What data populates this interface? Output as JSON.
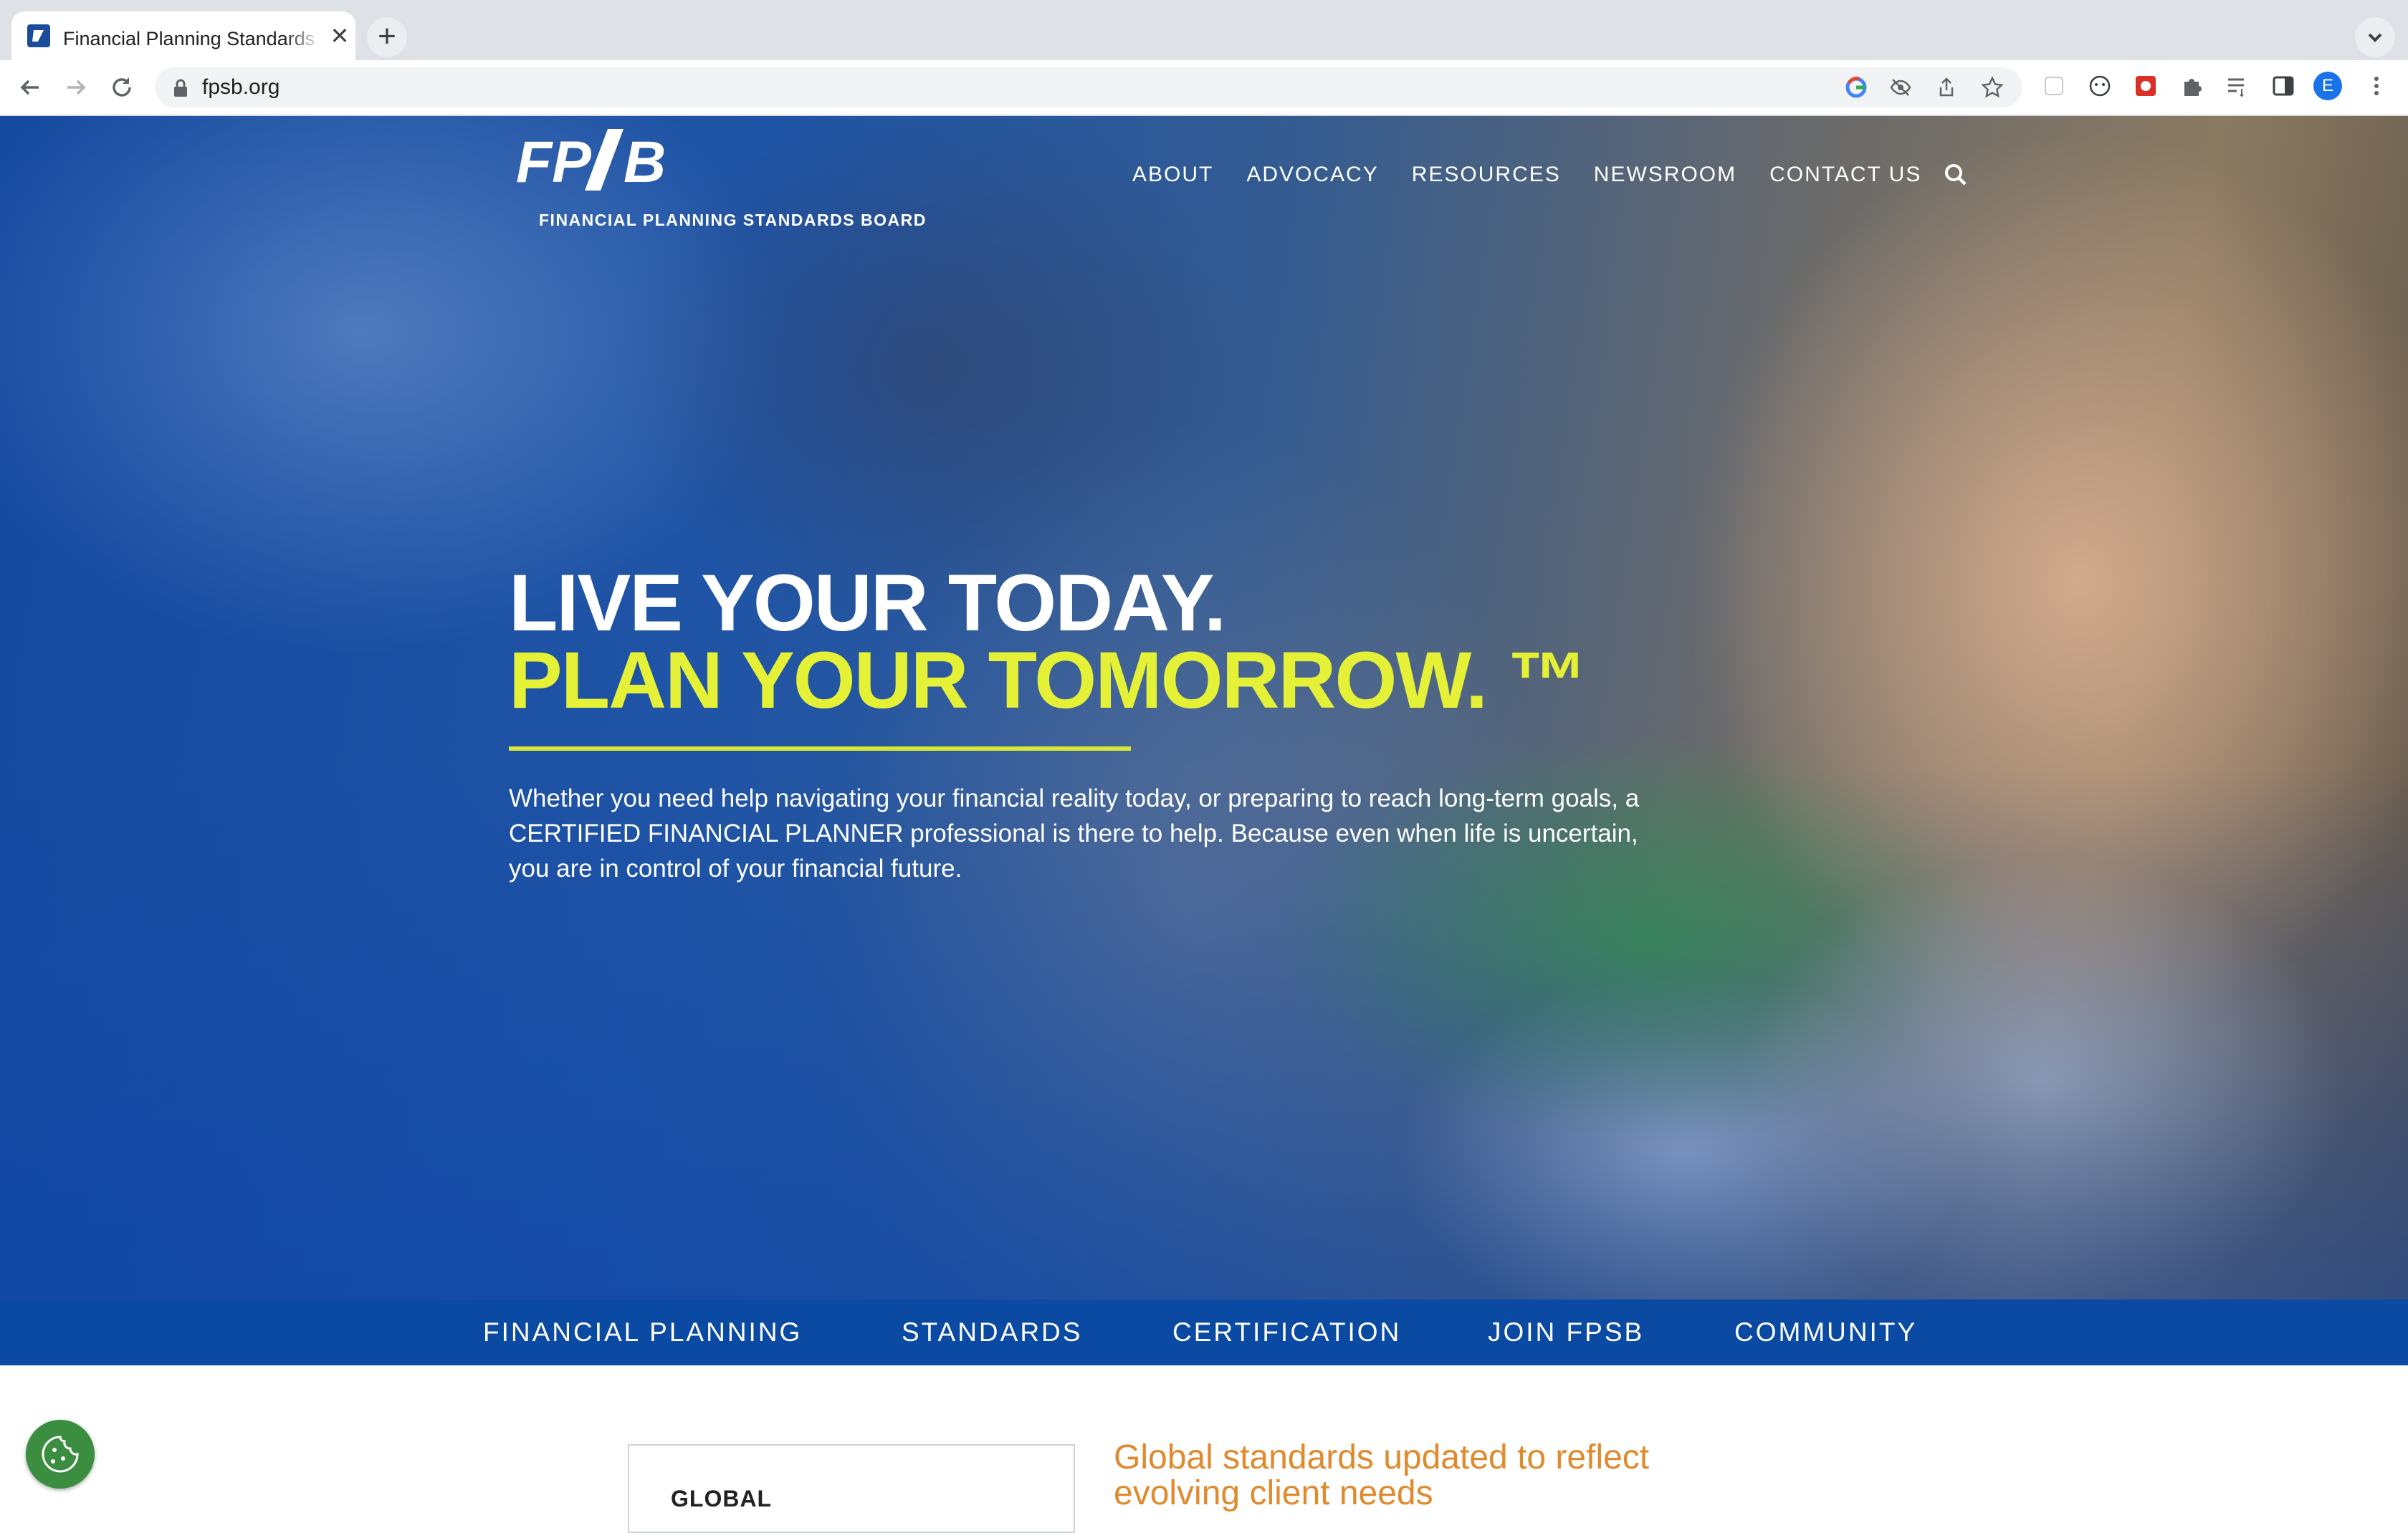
{
  "browser": {
    "tab_title": "Financial Planning Standards Board",
    "tab_close": "✕",
    "new_tab": "+",
    "url": "fpsb.org",
    "omnibox_icons": [
      "google-icon",
      "eye-slash-icon",
      "share-icon",
      "star-icon"
    ],
    "extension_icons": [
      "extension-placeholder-icon",
      "privacy-badger-icon",
      "red-extension-icon",
      "puzzle-icon",
      "reading-list-icon",
      "side-panel-icon"
    ],
    "profile_initial": "E"
  },
  "site": {
    "logo_text": "FPSB",
    "logo_subtitle": "FINANCIAL PLANNING STANDARDS BOARD",
    "top_nav": [
      "ABOUT",
      "ADVOCACY",
      "RESOURCES",
      "NEWSROOM",
      "CONTACT US"
    ]
  },
  "hero": {
    "headline_line1": "LIVE YOUR TODAY.",
    "headline_line2": "PLAN YOUR TOMORROW. ™",
    "body": "Whether you need help navigating your financial reality today, or preparing to reach long-term goals, a CERTIFIED FINANCIAL PLANNER professional is there to help. Because even when life is uncertain, you are in control of your financial future."
  },
  "main_nav": [
    "FINANCIAL PLANNING",
    "STANDARDS",
    "CERTIFICATION",
    "JOIN FPSB",
    "COMMUNITY"
  ],
  "below_fold": {
    "card_label": "GLOBAL",
    "news_title": "Global standards updated to reflect evolving client needs"
  },
  "colors": {
    "brand_blue": "#0b4aa2",
    "accent_yellow": "#e5f137",
    "news_orange": "#e08a2e",
    "cookie_green": "#3b8e3f"
  }
}
